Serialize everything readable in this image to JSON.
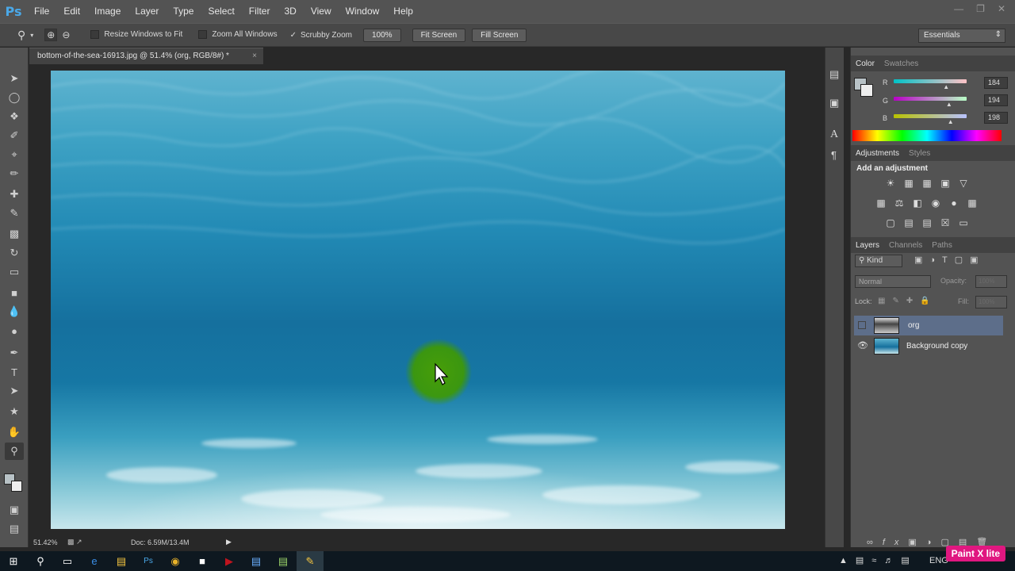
{
  "app": {
    "logo": "Ps"
  },
  "menu": [
    "File",
    "Edit",
    "Image",
    "Layer",
    "Type",
    "Select",
    "Filter",
    "3D",
    "View",
    "Window",
    "Help"
  ],
  "options": {
    "resize_windows": "Resize Windows to Fit",
    "zoom_all_windows": "Zoom All Windows",
    "scrubby_zoom": "Scrubby Zoom",
    "btn_100": "100%",
    "fit_screen": "Fit Screen",
    "fill_screen": "Fill Screen",
    "workspace": "Essentials"
  },
  "document": {
    "tab_title": "bottom-of-the-sea-16913.jpg @ 51.4% (org, RGB/8#) *",
    "close": "×",
    "zoom_readout": "51.42%",
    "doc_info": "Doc: 6.59M/13.4M"
  },
  "color_panel": {
    "tabs": [
      "Color",
      "Swatches"
    ],
    "r_label": "R",
    "g_label": "G",
    "b_label": "B",
    "r": "184",
    "g": "194",
    "b": "198",
    "r_level": 0.72,
    "g_level": 0.76,
    "b_level": 0.78
  },
  "adjustments_panel": {
    "tabs": [
      "Adjustments",
      "Styles"
    ],
    "heading": "Add an adjustment"
  },
  "layers_panel": {
    "tabs": [
      "Layers",
      "Channels",
      "Paths"
    ],
    "kind": "Kind",
    "blend_mode": "Normal",
    "opacity_label": "Opacity:",
    "opacity_value": "100%",
    "lock_label": "Lock:",
    "fill_label": "Fill:",
    "fill_value": "100%",
    "layers": [
      {
        "name": "org",
        "visible": false,
        "selected": true
      },
      {
        "name": "Background copy",
        "visible": true,
        "selected": false
      }
    ]
  },
  "taskbar": {
    "lang": "ENG",
    "watermark": "Paint X lite"
  },
  "colors": {
    "cursor_highlight": "#4aa000",
    "selected_layer": "#5d6e8a"
  }
}
